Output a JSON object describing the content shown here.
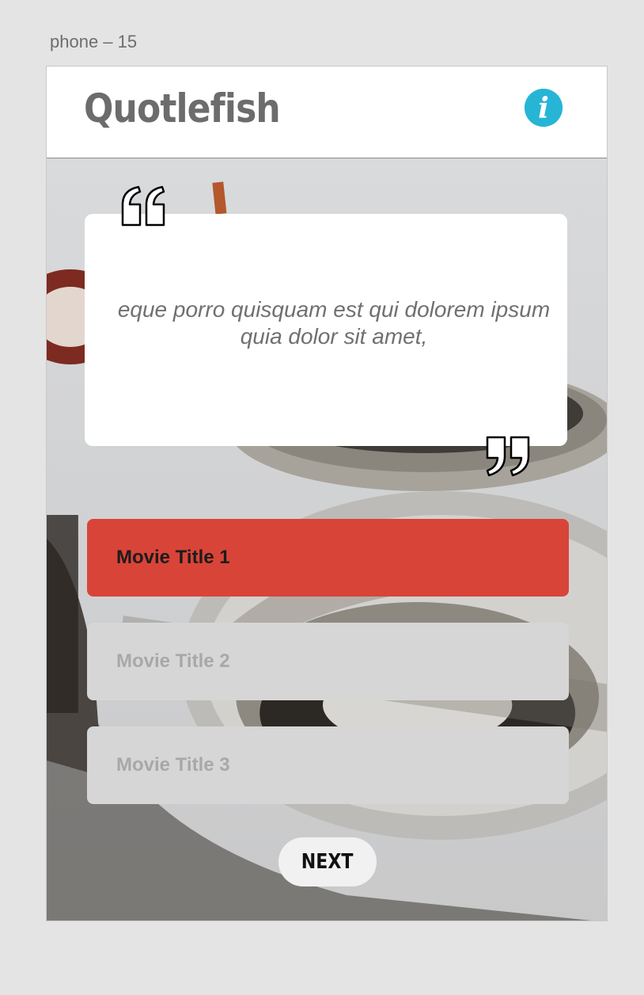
{
  "artboard": {
    "label": "phone – 15"
  },
  "header": {
    "title": "Quotlefish",
    "info_icon": "info-icon",
    "info_glyph": "i",
    "accent_color": "#27b5d6"
  },
  "background": {
    "description_icon": "film-reels-photo"
  },
  "quote": {
    "text": "eque porro quisquam est qui dolorem ipsum quia dolor sit amet,",
    "open_icon": "open-quote-icon",
    "close_icon": "close-quote-icon"
  },
  "options": [
    {
      "label": "Movie Title 1",
      "state": "selected",
      "color": "#d94438"
    },
    {
      "label": "Movie Title 2",
      "state": "unselected",
      "color": "#d6d6d6"
    },
    {
      "label": "Movie Title 3",
      "state": "unselected",
      "color": "#d6d6d6"
    }
  ],
  "next_button": {
    "label": "NEXT"
  }
}
